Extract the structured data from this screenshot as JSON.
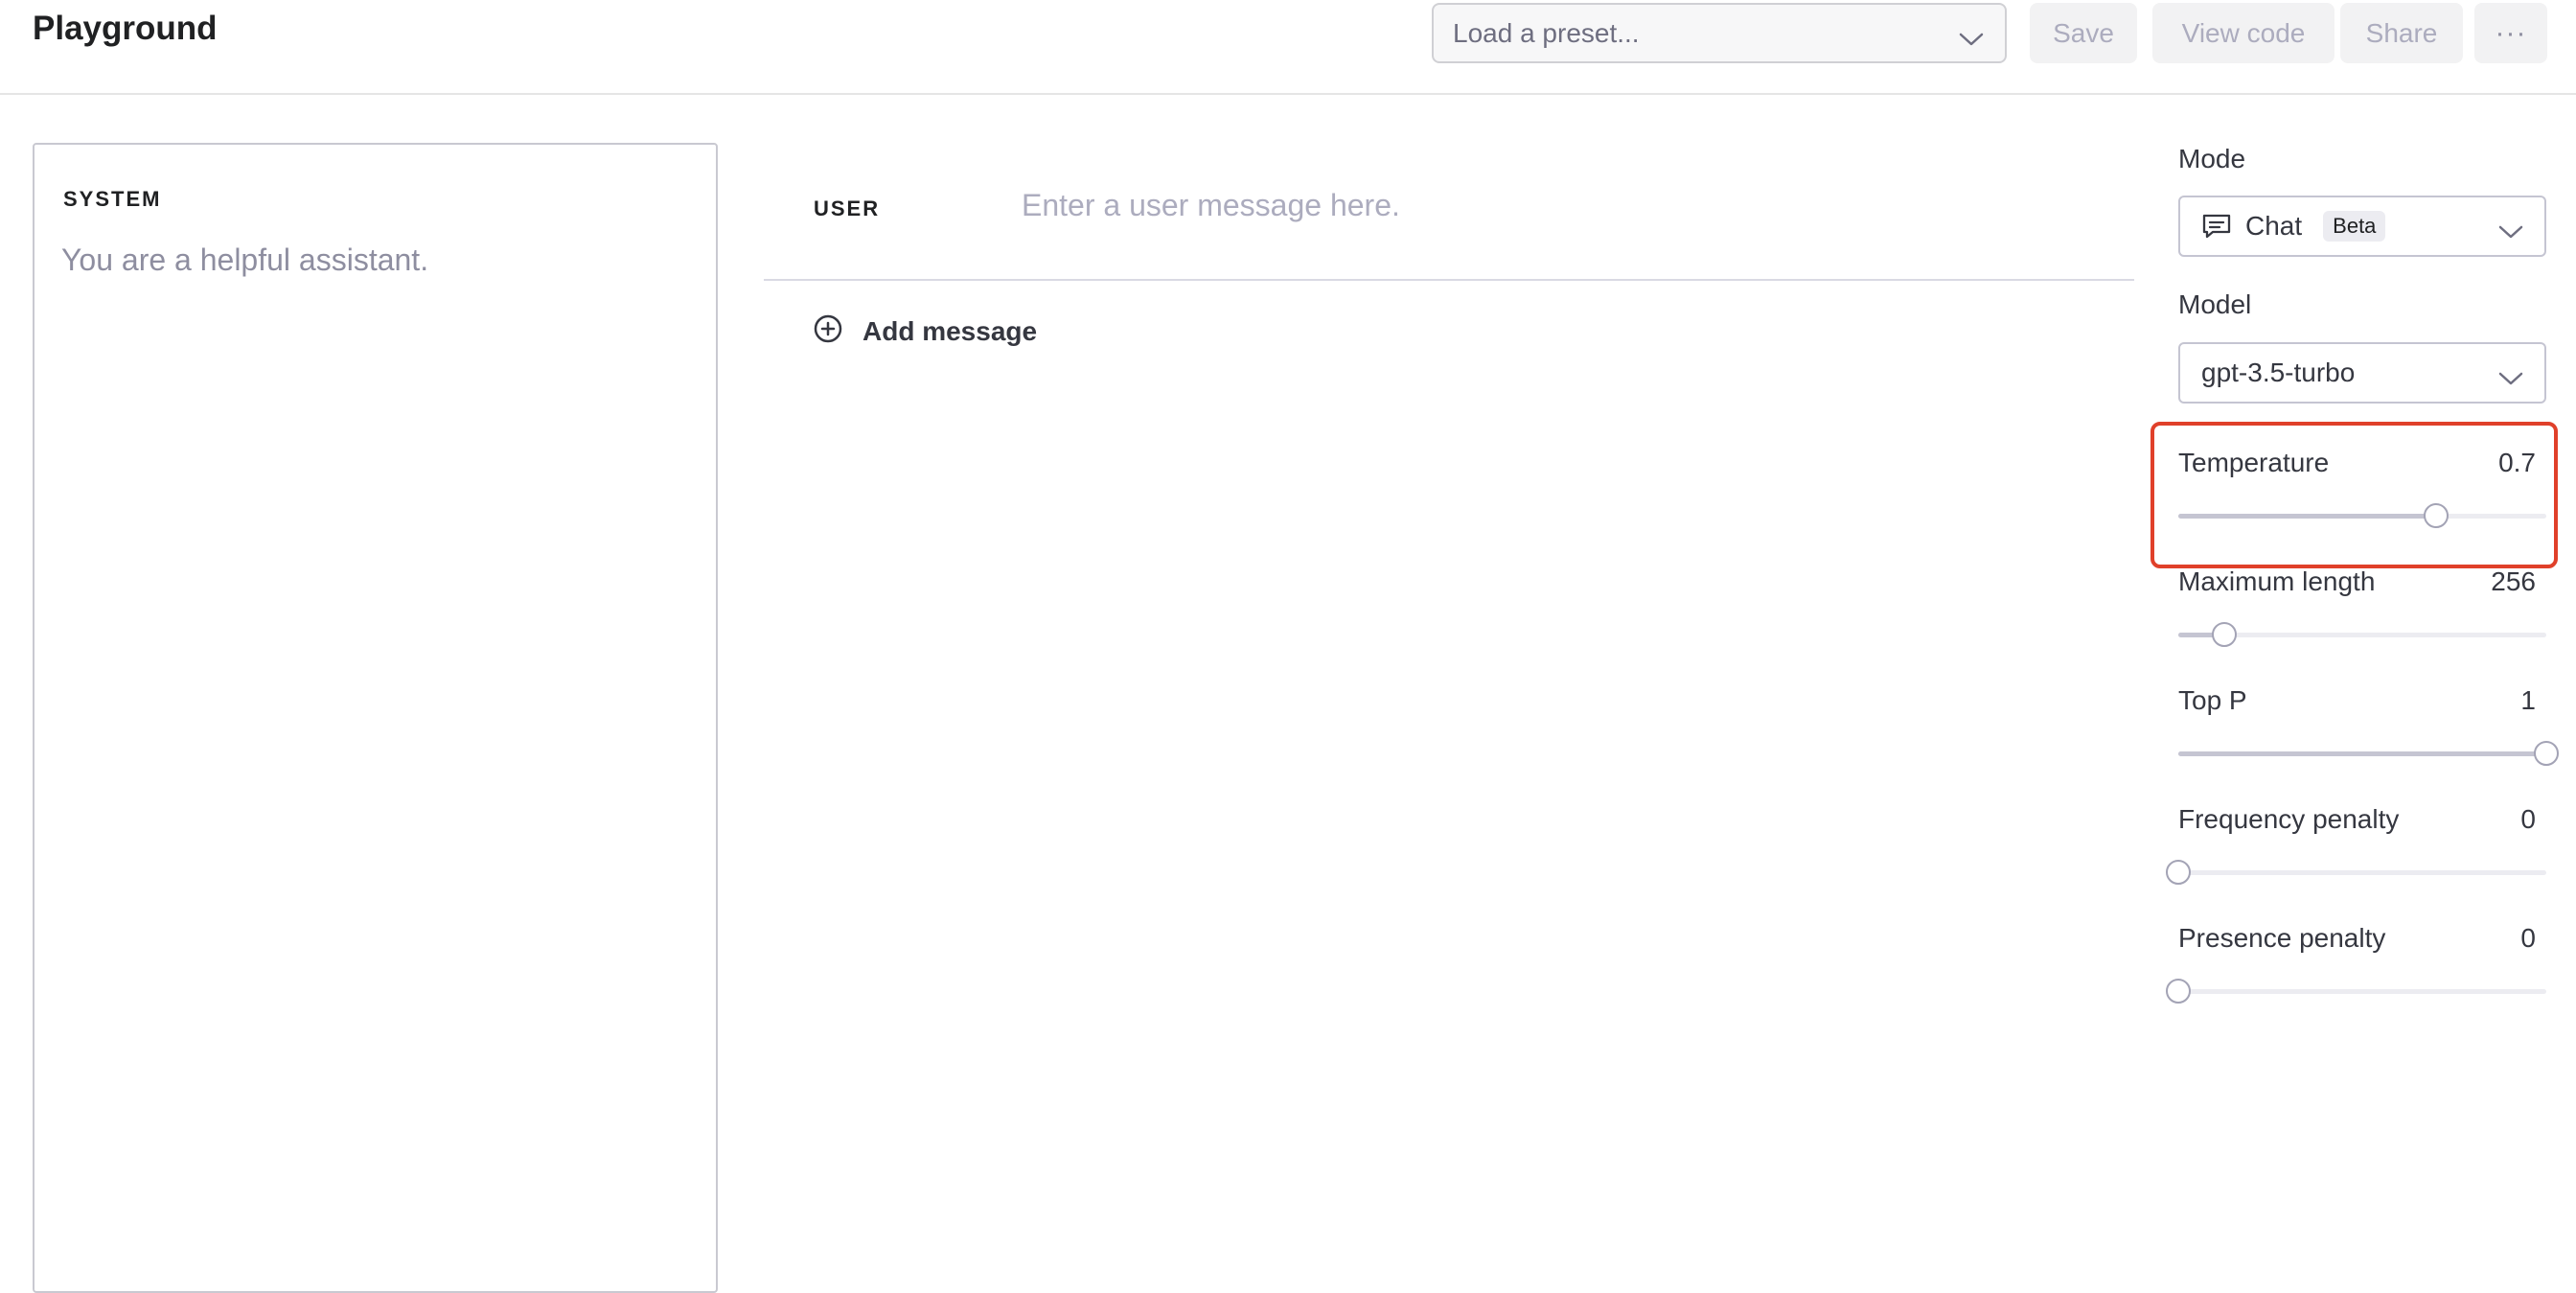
{
  "header": {
    "title": "Playground",
    "preset_placeholder": "Load a preset...",
    "save_label": "Save",
    "view_code_label": "View code",
    "share_label": "Share",
    "more_label": "···"
  },
  "system": {
    "label": "SYSTEM",
    "placeholder": "You are a helpful assistant."
  },
  "chat": {
    "user_label": "USER",
    "user_placeholder": "Enter a user message here.",
    "add_message_label": "Add message"
  },
  "settings": {
    "mode_label": "Mode",
    "mode_value": "Chat",
    "mode_badge": "Beta",
    "model_label": "Model",
    "model_value": "gpt-3.5-turbo",
    "sliders": [
      {
        "label": "Temperature",
        "value": "0.7",
        "fraction": 0.7
      },
      {
        "label": "Maximum length",
        "value": "256",
        "fraction": 0.125
      },
      {
        "label": "Top P",
        "value": "1",
        "fraction": 1.0
      },
      {
        "label": "Frequency penalty",
        "value": "0",
        "fraction": 0.0
      },
      {
        "label": "Presence penalty",
        "value": "0",
        "fraction": 0.0
      }
    ]
  },
  "colors": {
    "highlight": "#e0402a",
    "slider_fill": "#c5c5d2",
    "slider_track": "#ececf1"
  }
}
